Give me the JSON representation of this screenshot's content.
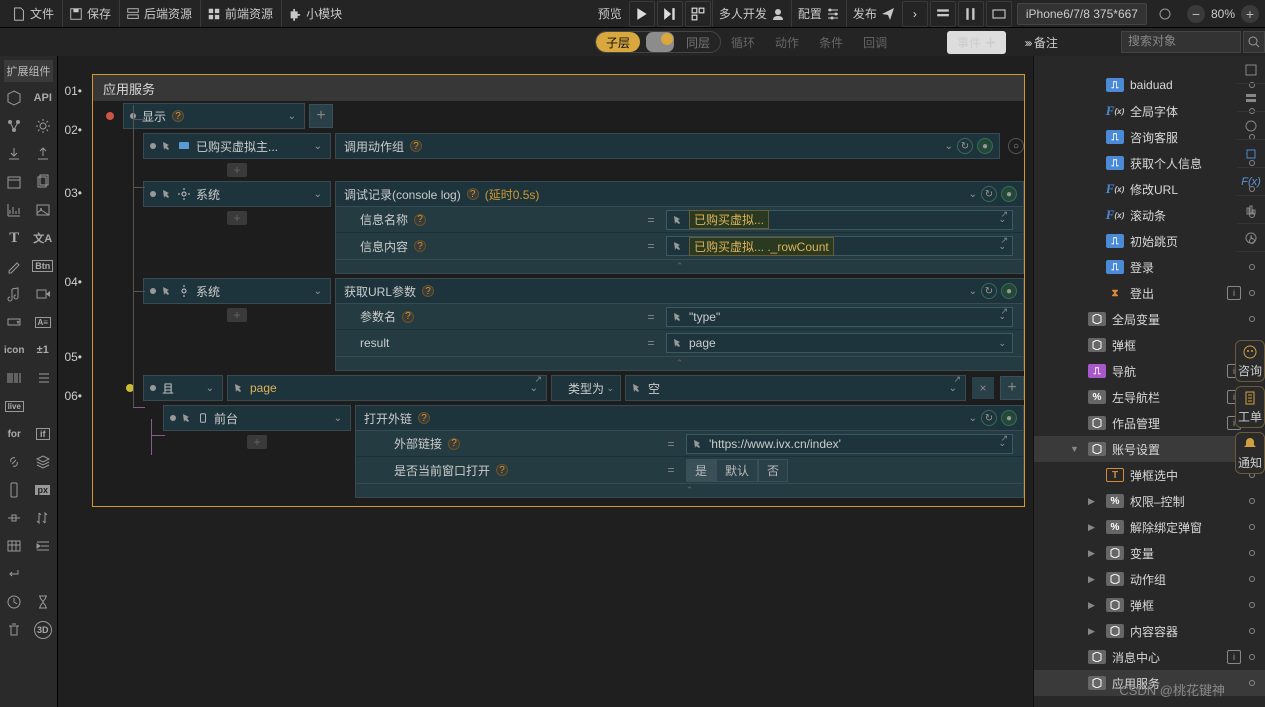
{
  "topbar": {
    "file": "文件",
    "save": "保存",
    "backend": "后端资源",
    "frontend": "前端资源",
    "module": "小模块",
    "preview": "预览",
    "multi": "多人开发",
    "config": "配置",
    "publish": "发布",
    "device": "iPhone6/7/8 375*667",
    "zoom": "80%"
  },
  "subbar": {
    "child": "子层",
    "same": "同层",
    "loop": "循环",
    "action": "动作",
    "cond": "条件",
    "callback": "回调",
    "event": "事件",
    "remark": "备注",
    "search_ph": "搜索对象"
  },
  "left": {
    "ext": "扩展组件",
    "api": "API"
  },
  "gutter": [
    "01•",
    "02•",
    "03•",
    "04•",
    "05•",
    "06•"
  ],
  "panel": {
    "title": "应用服务",
    "n1": {
      "label": "显示"
    },
    "n2": {
      "label": "已购买虚拟主...",
      "action": "调用动作组"
    },
    "n3": {
      "label": "系统",
      "action": "调试记录(console log)",
      "delay": "(延时0.5s)",
      "p1": {
        "k": "信息名称",
        "v": "已购买虚拟..."
      },
      "p2": {
        "k": "信息内容",
        "v": "已购买虚拟... ._rowCount"
      }
    },
    "n4": {
      "label": "系统",
      "action": "获取URL参数",
      "p1": {
        "k": "参数名",
        "v": "\"type\""
      },
      "p2": {
        "k": "result",
        "v": "page"
      }
    },
    "n5": {
      "label": "且",
      "var": "page",
      "mid": "类型为",
      "val": "空"
    },
    "n6": {
      "label": "前台",
      "action": "打开外链",
      "p1": {
        "k": "外部链接",
        "v": "'https://www.ivx.cn/index'"
      },
      "p2": {
        "k": "是否当前窗口打开",
        "yes": "是",
        "def": "默认",
        "no": "否"
      }
    }
  },
  "tree": [
    {
      "ic": "b",
      "t": "baiduad",
      "pad": 54
    },
    {
      "ic": "v",
      "t": "全局字体",
      "pad": 54,
      "fx": 1
    },
    {
      "ic": "b",
      "t": "咨询客服",
      "pad": 54
    },
    {
      "ic": "b",
      "t": "获取个人信息",
      "pad": 54
    },
    {
      "ic": "v",
      "t": "修改URL",
      "pad": 54,
      "fx": 1
    },
    {
      "ic": "v",
      "t": "滚动条",
      "pad": 54,
      "fx": 1
    },
    {
      "ic": "b",
      "t": "初始跳页",
      "pad": 54
    },
    {
      "ic": "b",
      "t": "登录",
      "pad": 54
    },
    {
      "ic": "o",
      "t": "登出",
      "pad": 54,
      "info": 1,
      "hg": 1
    },
    {
      "ic": "g",
      "t": "全局变量",
      "pad": 36,
      "box": 1
    },
    {
      "ic": "g",
      "t": "弹框",
      "pad": 36,
      "box": 1
    },
    {
      "ic": "p",
      "t": "导航",
      "pad": 36,
      "info": 1
    },
    {
      "ic": "g",
      "t": "左导航栏",
      "pad": 36,
      "info": 1,
      "pct": 1
    },
    {
      "ic": "g",
      "t": "作品管理",
      "pad": 36,
      "info": 1,
      "box": 1
    },
    {
      "ic": "g",
      "t": "账号设置",
      "pad": 36,
      "sel": 1,
      "box": 1,
      "tri": "▼"
    },
    {
      "ic": "o",
      "t": "弹框选中",
      "pad": 54,
      "T": 1
    },
    {
      "ic": "g",
      "t": "权限–控制",
      "pad": 54,
      "tri": "▶",
      "pct": 1
    },
    {
      "ic": "g",
      "t": "解除绑定弹窗",
      "pad": 54,
      "tri": "▶",
      "pct": 1
    },
    {
      "ic": "g",
      "t": "变量",
      "pad": 54,
      "tri": "▶",
      "box": 1
    },
    {
      "ic": "g",
      "t": "动作组",
      "pad": 54,
      "tri": "▶",
      "box": 1
    },
    {
      "ic": "g",
      "t": "弹框",
      "pad": 54,
      "tri": "▶",
      "box": 1
    },
    {
      "ic": "g",
      "t": "内容容器",
      "pad": 54,
      "tri": "▶",
      "box": 1
    },
    {
      "ic": "g",
      "t": "消息中心",
      "pad": 36,
      "info": 1,
      "box": 1
    },
    {
      "ic": "g",
      "t": "应用服务",
      "pad": 36,
      "sel": 1,
      "box": 1
    }
  ],
  "float": {
    "consult": "咨询",
    "order": "工单",
    "notice": "通知"
  },
  "watermark": "CSDN @桃花键神"
}
